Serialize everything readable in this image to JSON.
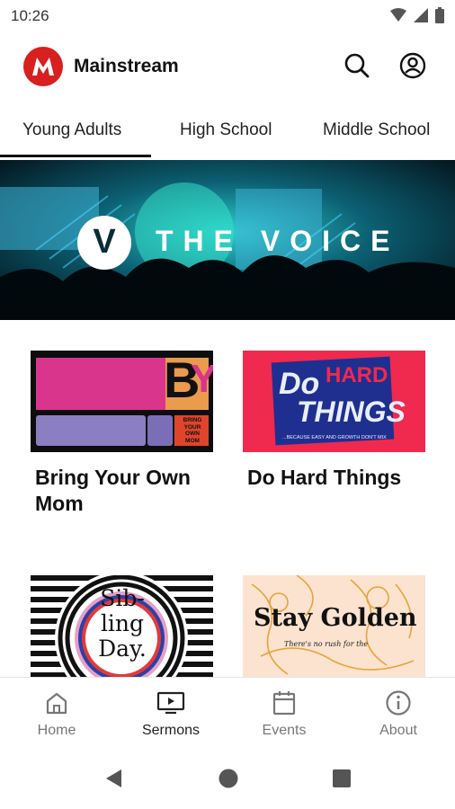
{
  "status_bar": {
    "time": "10:26"
  },
  "app_bar": {
    "logo_letter": "M",
    "app_name": "Mainstream"
  },
  "tabs": [
    {
      "label": "Young Adults",
      "selected": true
    },
    {
      "label": "High School",
      "selected": false
    },
    {
      "label": "Middle School",
      "selected": false
    }
  ],
  "banner": {
    "mark": "V",
    "title": "THE VOICE"
  },
  "series": [
    {
      "title": "Bring Your Own Mom",
      "art_text": [
        "B",
        "Y",
        "BRING",
        "YOUR",
        "OWN",
        "MOM"
      ]
    },
    {
      "title": "Do Hard Things",
      "art_text": [
        "Do",
        "HARD",
        "THINGS",
        "...BECAUSE EASY AND GROWTH DON'T MIX"
      ]
    },
    {
      "title": "Sibling Day",
      "art_text": [
        "Sib-",
        "ling",
        "Day."
      ]
    },
    {
      "title": "Stay Golden",
      "art_text": [
        "Stay Golden",
        "There's no rush for the"
      ]
    }
  ],
  "bottom_nav": [
    {
      "label": "Home",
      "icon": "home-icon",
      "active": false
    },
    {
      "label": "Sermons",
      "icon": "sermons-icon",
      "active": true
    },
    {
      "label": "Events",
      "icon": "calendar-icon",
      "active": false
    },
    {
      "label": "About",
      "icon": "info-icon",
      "active": false
    }
  ],
  "colors": {
    "brand": "#d7201f",
    "bym_pink": "#d9358c",
    "bym_purple": "#8b7fc2",
    "dht_red": "#f0294f",
    "dht_blue": "#1f2f8f"
  }
}
